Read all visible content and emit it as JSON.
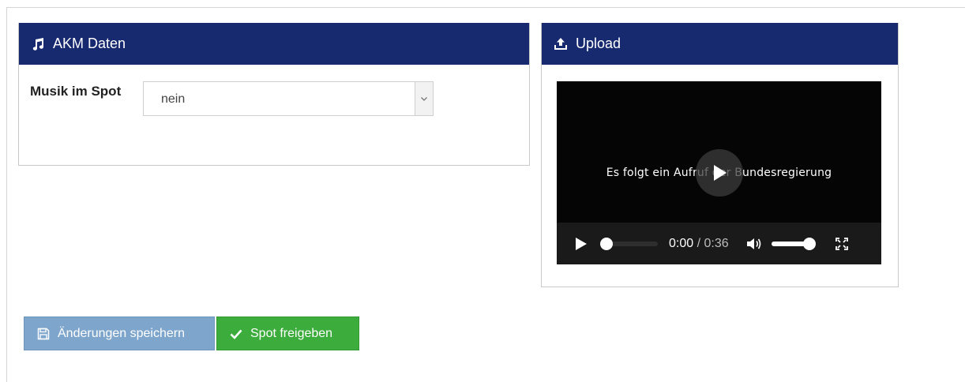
{
  "akm": {
    "title": "AKM Daten",
    "icon": "music-note-icon",
    "music_label": "Musik im Spot",
    "music_value": "nein"
  },
  "upload": {
    "title": "Upload",
    "icon": "upload-icon",
    "video": {
      "caption": "Es folgt ein Aufruf der Bundesregierung",
      "current_time": "0:00",
      "duration": "/ 0:36",
      "progress": 0,
      "volume": 1.0
    }
  },
  "actions": {
    "save_label": "Änderungen speichern",
    "release_label": "Spot freigeben"
  },
  "colors": {
    "header": "#172a6f",
    "save": "#7ea5cc",
    "release": "#3cac3c"
  }
}
